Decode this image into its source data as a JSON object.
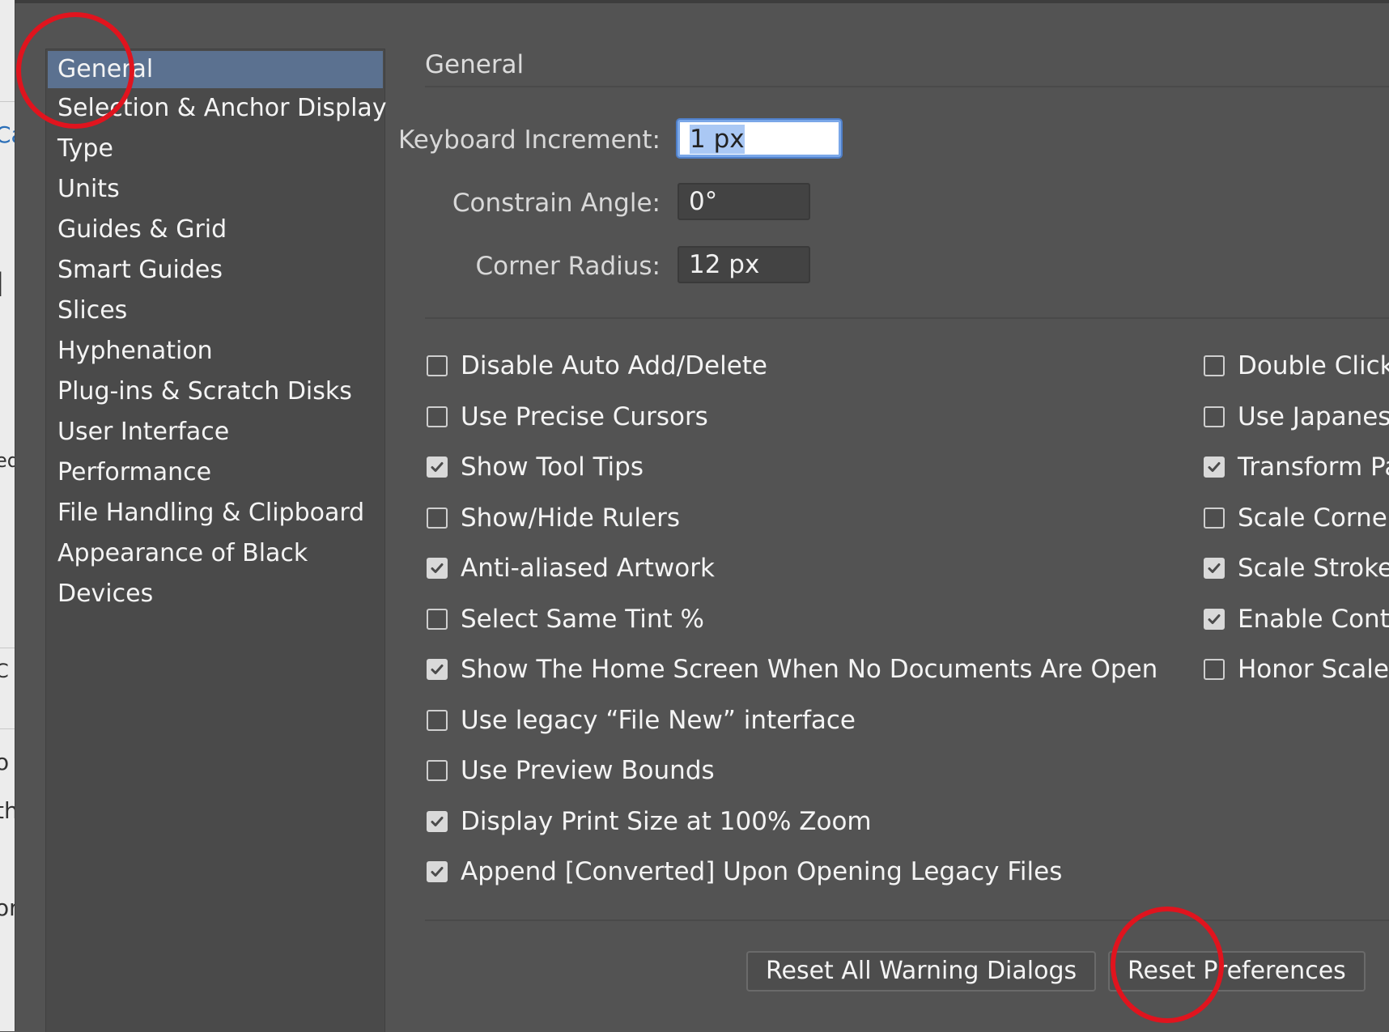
{
  "background_fragments": [
    "Ca",
    "l",
    "ed",
    "C",
    "o",
    "th",
    "or"
  ],
  "sidebar": {
    "items": [
      {
        "label": "General",
        "active": true
      },
      {
        "label": "Selection & Anchor Display",
        "active": false
      },
      {
        "label": "Type",
        "active": false
      },
      {
        "label": "Units",
        "active": false
      },
      {
        "label": "Guides & Grid",
        "active": false
      },
      {
        "label": "Smart Guides",
        "active": false
      },
      {
        "label": "Slices",
        "active": false
      },
      {
        "label": "Hyphenation",
        "active": false
      },
      {
        "label": "Plug-ins & Scratch Disks",
        "active": false
      },
      {
        "label": "User Interface",
        "active": false
      },
      {
        "label": "Performance",
        "active": false
      },
      {
        "label": "File Handling & Clipboard",
        "active": false
      },
      {
        "label": "Appearance of Black",
        "active": false
      },
      {
        "label": "Devices",
        "active": false
      }
    ]
  },
  "main": {
    "title": "General",
    "fields": {
      "keyboard_increment": {
        "label": "Keyboard Increment:",
        "value": "1 px"
      },
      "constrain_angle": {
        "label": "Constrain Angle:",
        "value": "0°"
      },
      "corner_radius": {
        "label": "Corner Radius:",
        "value": "12 px"
      }
    },
    "checkboxes_left": [
      {
        "label": "Disable Auto Add/Delete",
        "checked": false
      },
      {
        "label": "Use Precise Cursors",
        "checked": false
      },
      {
        "label": "Show Tool Tips",
        "checked": true
      },
      {
        "label": "Show/Hide Rulers",
        "checked": false
      },
      {
        "label": "Anti-aliased Artwork",
        "checked": true
      },
      {
        "label": "Select Same Tint %",
        "checked": false
      },
      {
        "label": "Show The Home Screen When No Documents Are Open",
        "checked": true
      },
      {
        "label": "Use legacy “File New” interface",
        "checked": false
      },
      {
        "label": "Use Preview Bounds",
        "checked": false
      },
      {
        "label": "Display Print Size at 100% Zoom",
        "checked": true
      },
      {
        "label": "Append [Converted] Upon Opening Legacy Files",
        "checked": true
      }
    ],
    "checkboxes_right": [
      {
        "label": "Double Click",
        "checked": false
      },
      {
        "label": "Use Japanese",
        "checked": false
      },
      {
        "label": "Transform Pa",
        "checked": true
      },
      {
        "label": "Scale Corners",
        "checked": false
      },
      {
        "label": "Scale Strokes",
        "checked": true
      },
      {
        "label": "Enable Conte",
        "checked": true
      },
      {
        "label": "Honor Scale",
        "checked": false
      }
    ],
    "buttons": {
      "reset_warnings": "Reset All Warning Dialogs",
      "reset_prefs": "Reset Preferences"
    }
  },
  "colors": {
    "panel": "#535353",
    "sidebar": "#4a4a4a",
    "selection": "#5b7190",
    "annotation": "#e0141e",
    "focus": "#7aa7e8"
  }
}
